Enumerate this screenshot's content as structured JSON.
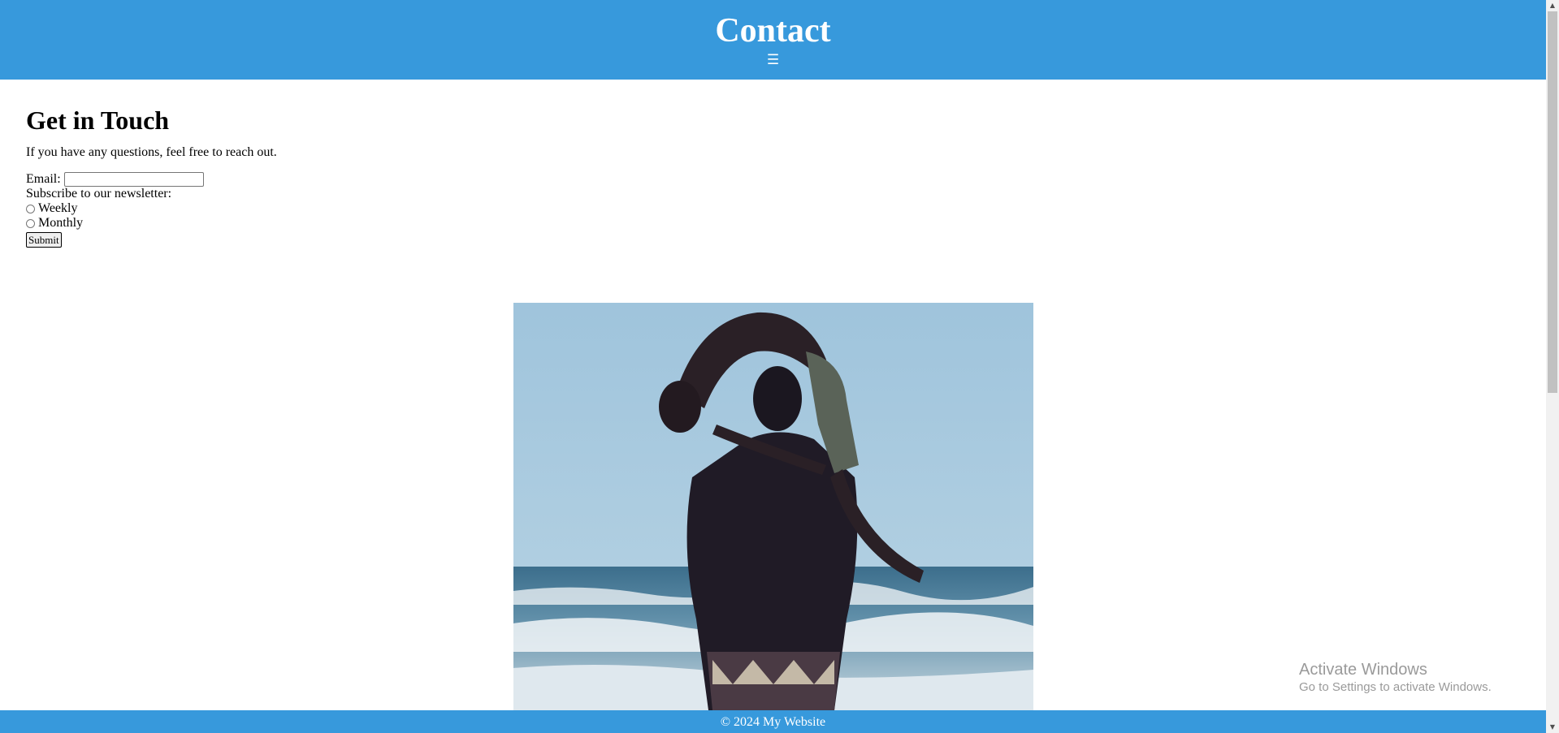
{
  "header": {
    "title": "Contact",
    "menu_icon": "☰"
  },
  "main": {
    "heading": "Get in Touch",
    "intro": "If you have any questions, feel free to reach out.",
    "form": {
      "email_label": "Email:",
      "email_value": "",
      "newsletter_label": "Subscribe to our newsletter:",
      "options": [
        "Weekly",
        "Monthly"
      ],
      "submit_label": "Submit"
    }
  },
  "footer": {
    "text": "© 2024 My Website"
  },
  "watermark": {
    "line1": "Activate Windows",
    "line2": "Go to Settings to activate Windows."
  },
  "colors": {
    "accent": "#3799dc"
  }
}
